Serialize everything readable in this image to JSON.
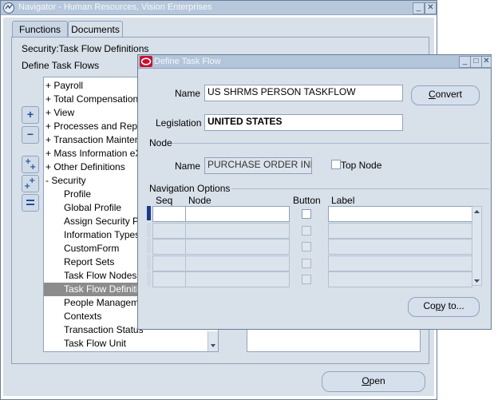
{
  "navigator": {
    "title": "Navigator - Human Resources, Vision Enterprises",
    "tabs": [
      {
        "label": "Functions"
      },
      {
        "label": "Documents"
      }
    ],
    "context_label": "Security:Task Flow Definitions",
    "section_label": "Define Task Flows",
    "tree_items": [
      {
        "label": "+  Payroll"
      },
      {
        "label": "+  Total Compensation"
      },
      {
        "label": "+  View"
      },
      {
        "label": "+  Processes and Repo"
      },
      {
        "label": "+  Transaction Maintena"
      },
      {
        "label": "+  Mass Information eXc"
      },
      {
        "label": "+  Other Definitions"
      },
      {
        "label": "-  Security"
      },
      {
        "label": "Profile"
      },
      {
        "label": "Global Profile"
      },
      {
        "label": "Assign Security Pr"
      },
      {
        "label": "Information Types S"
      },
      {
        "label": "CustomForm"
      },
      {
        "label": "Report Sets"
      },
      {
        "label": "Task Flow Nodes"
      },
      {
        "label": "Task Flow Definitio"
      },
      {
        "label": "People Manageme"
      },
      {
        "label": "Contexts"
      },
      {
        "label": "Transaction Status"
      },
      {
        "label": "Task Flow Unit"
      }
    ],
    "selected_index": 15,
    "open_label": "Open",
    "open_underline": "O",
    "open_rest": "pen"
  },
  "dialog": {
    "title": "Define Task Flow",
    "name_label": "Name",
    "name_value": "US SHRMS PERSON TASKFLOW",
    "convert_label": "Convert",
    "convert_underline": "C",
    "convert_rest": "onvert",
    "legislation_label": "Legislation",
    "legislation_value": "UNITED STATES",
    "node_section": "Node",
    "node_name_label": "Name",
    "node_name_value": "PURCHASE ORDER INFO",
    "top_node_label": "Top Node",
    "nav_options_section": "Navigation Options",
    "col_seq": "Seq",
    "col_node": "Node",
    "col_button": "Button",
    "col_label": "Label",
    "row_count": 5,
    "copy_label": "Copy to...",
    "copy_underline": "p",
    "copy_before": "Co",
    "copy_after": "y to..."
  },
  "colors": {
    "window_bg": "#d8e0ea",
    "title_bar": "#b8c8dc",
    "selected_row": "#8c8c8c"
  }
}
